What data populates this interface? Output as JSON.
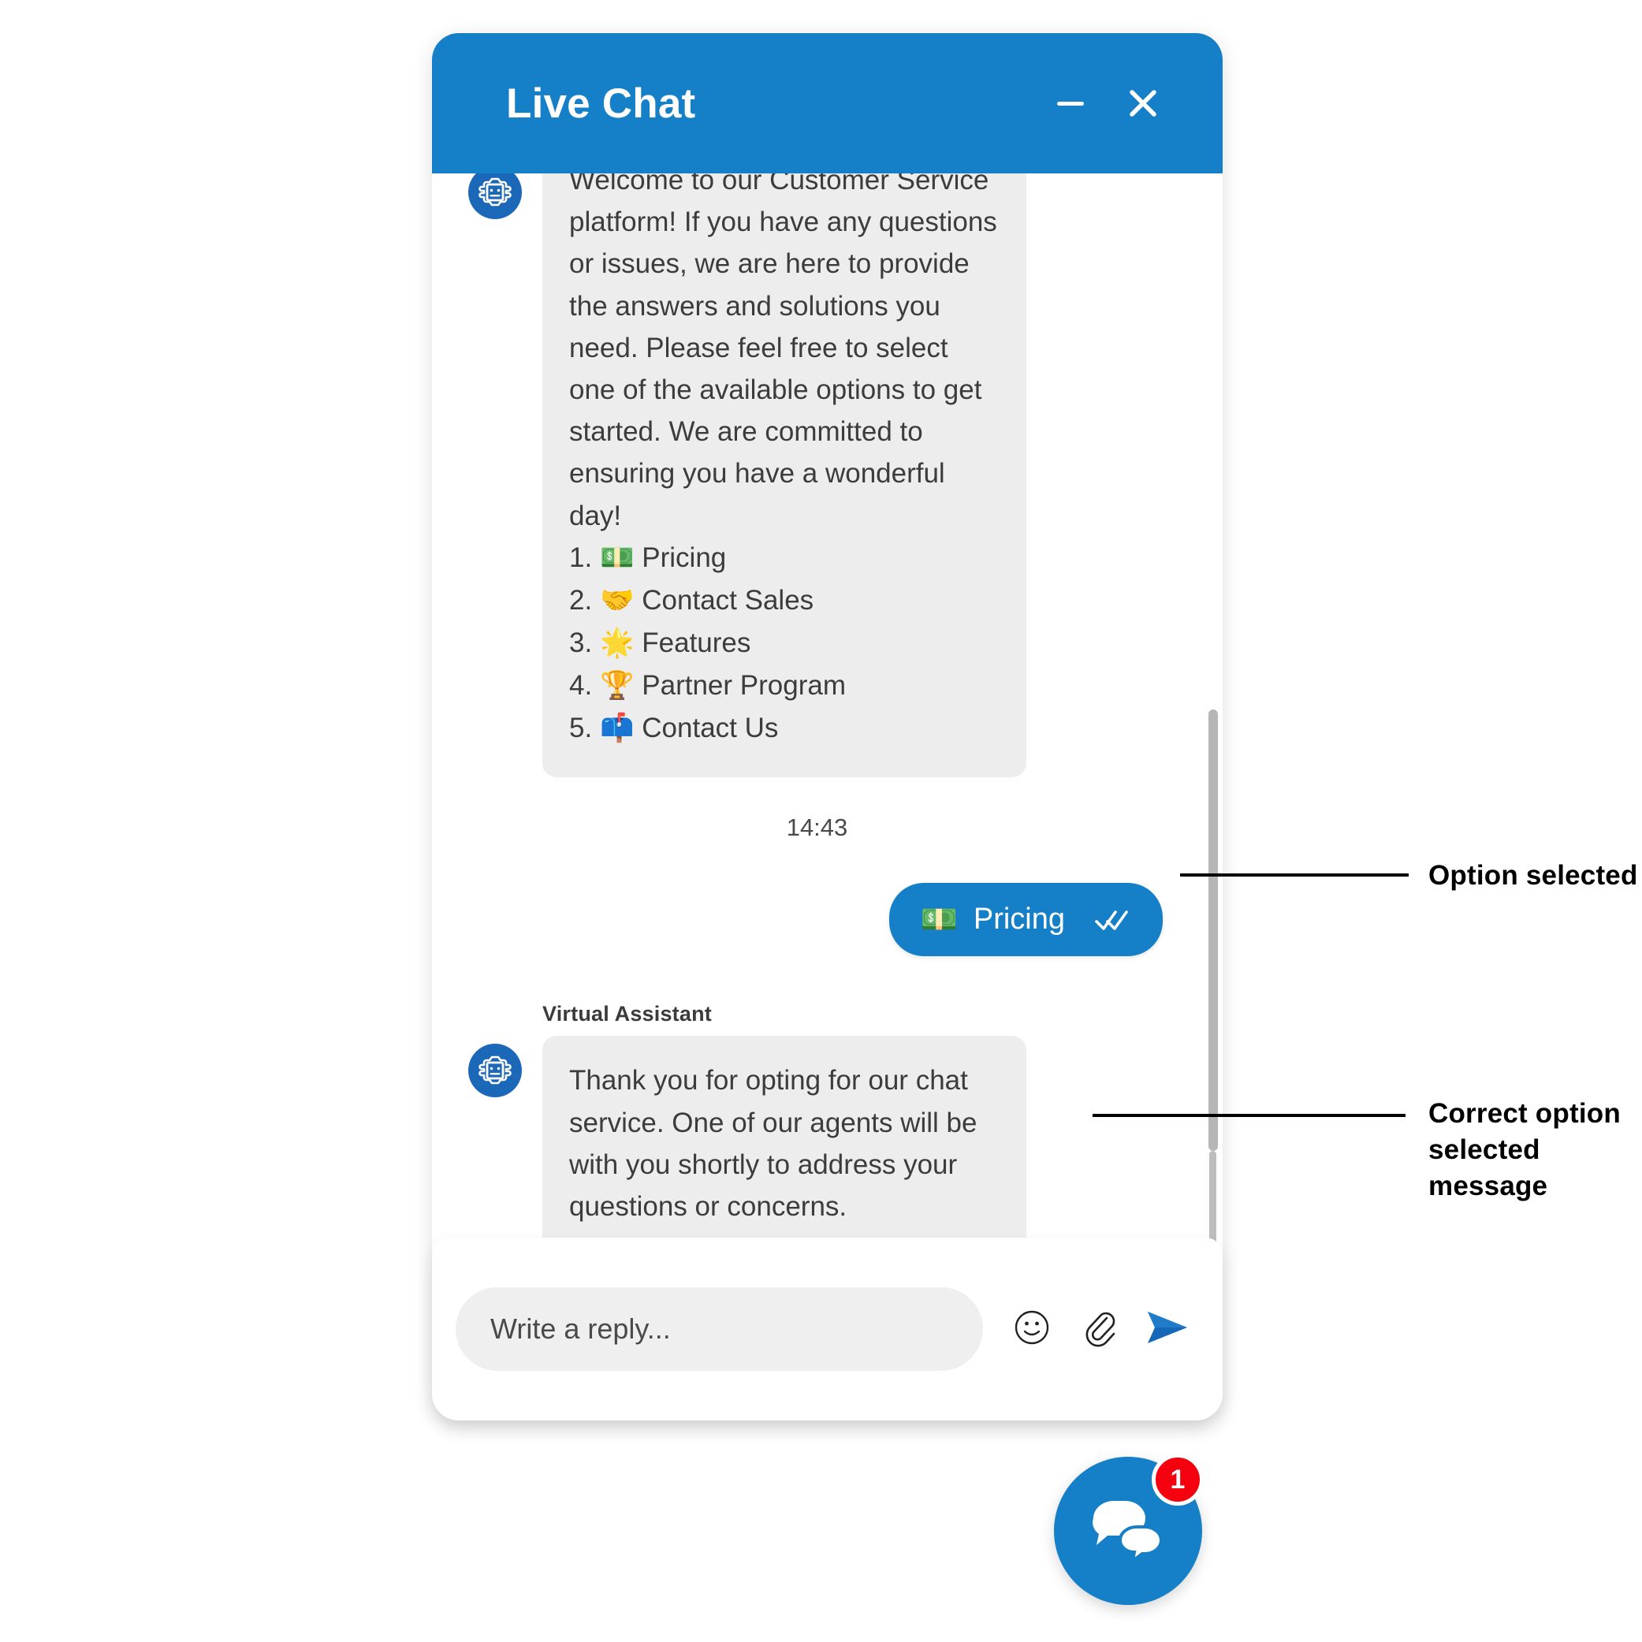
{
  "window": {
    "title": "Live Chat",
    "minimize_icon": "minimize-icon",
    "close_icon": "close-icon",
    "header_color": "#1580C8"
  },
  "messages": [
    {
      "sender": "bot",
      "avatar_icon": "robot-icon",
      "text": "Welcome to our Customer Service platform! If you have any questions or issues, we are here to provide the answers and solutions you need. Please feel free to select one of the available options to get started. We are committed to ensuring you have a wonderful day!",
      "options": [
        {
          "number": "1.",
          "emoji": "💵",
          "label": "Pricing"
        },
        {
          "number": "2.",
          "emoji": "🤝",
          "label": "Contact Sales"
        },
        {
          "number": "3.",
          "emoji": "🌟",
          "label": "Features"
        },
        {
          "number": "4.",
          "emoji": "🏆",
          "label": "Partner Program"
        },
        {
          "number": "5.",
          "emoji": "📫",
          "label": "Contact Us"
        }
      ]
    }
  ],
  "timestamp": "14:43",
  "user_message": {
    "emoji": "💵",
    "label": "Pricing",
    "read_status_icon": "double-check-icon"
  },
  "assistant_reply": {
    "sender_name": "Virtual Assistant",
    "avatar_icon": "robot-icon",
    "text": "Thank you for opting for our chat service. One of our agents will be with you shortly to address your questions or concerns."
  },
  "composer": {
    "placeholder": "Write a reply...",
    "value": "",
    "emoji_icon": "smiley-icon",
    "attach_icon": "paperclip-icon",
    "send_icon": "send-icon"
  },
  "fab": {
    "icon": "chat-bubbles-icon",
    "badge_count": "1",
    "badge_color": "#F5000F",
    "color": "#1580C8"
  },
  "annotations": [
    {
      "label": "Option selected"
    },
    {
      "label_line1": "Correct option",
      "label_line2": "selected message"
    }
  ]
}
